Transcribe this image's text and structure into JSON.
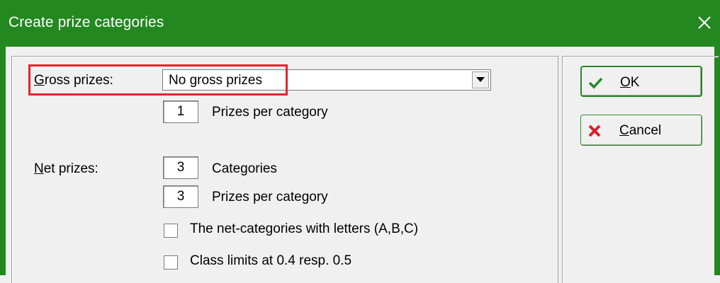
{
  "window": {
    "title": "Create prize categories",
    "close_icon": "close-icon",
    "title_color": "#23881f"
  },
  "gross": {
    "label_mnemonic": "G",
    "label_rest": "ross prizes:",
    "selected": "No gross prizes",
    "prizes_per_category_value": "1",
    "prizes_per_category_label": "Prizes per category"
  },
  "net": {
    "label_mnemonic": "N",
    "label_rest": "et prizes:",
    "categories_value": "3",
    "categories_label": "Categories",
    "prizes_per_category_value": "3",
    "prizes_per_category_label": "Prizes per category",
    "letters_checkbox_label": "The net-categories with letters (A,B,C)",
    "letters_checked": false,
    "class_limits_label": "Class limits at 0.4 resp. 0.5",
    "class_limits_checked": false
  },
  "buttons": {
    "ok_mnemonic": "O",
    "ok_rest": "K",
    "ok_icon": "checkmark-icon",
    "cancel_mnemonic": "C",
    "cancel_rest": "ancel",
    "cancel_icon": "red-x-icon"
  },
  "highlight_color": "#e8232d"
}
